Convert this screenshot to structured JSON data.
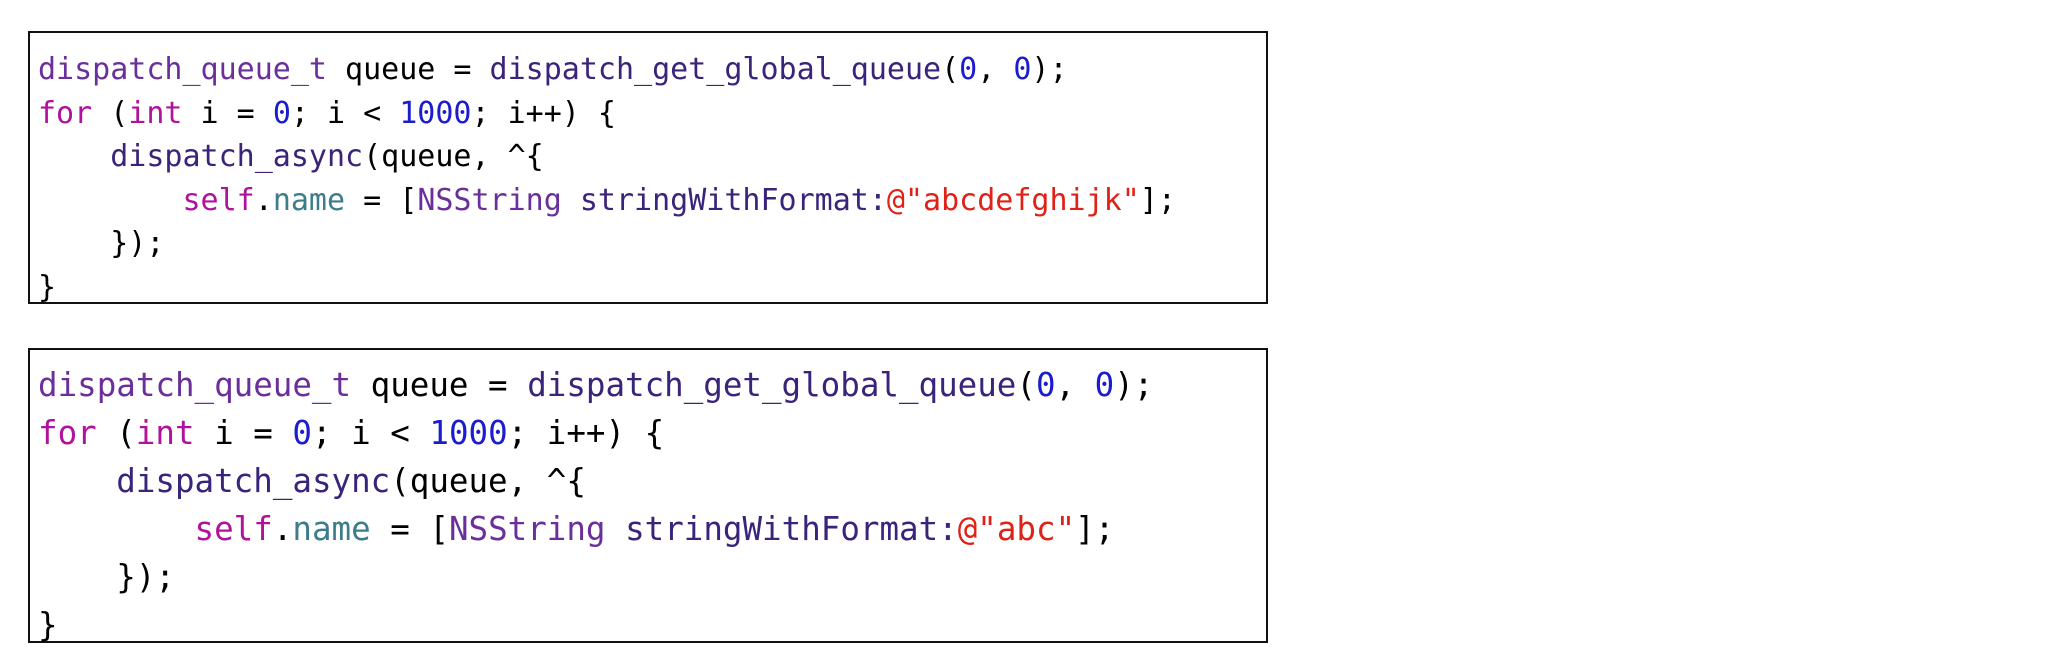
{
  "colors": {
    "plain": "#000000",
    "keyword": "#b0129c",
    "type": "#6a2f9a",
    "number": "#1c1ccf",
    "string": "#e02118",
    "property": "#3c7d8a",
    "class": "#6a2f9a",
    "method": "#3a237a"
  },
  "snippets": [
    {
      "lines": [
        [
          {
            "text": "dispatch_queue_t",
            "kind": "type"
          },
          {
            "text": " queue = ",
            "kind": "plain"
          },
          {
            "text": "dispatch_get_global_queue",
            "kind": "method"
          },
          {
            "text": "(",
            "kind": "plain"
          },
          {
            "text": "0",
            "kind": "number"
          },
          {
            "text": ", ",
            "kind": "plain"
          },
          {
            "text": "0",
            "kind": "number"
          },
          {
            "text": ");",
            "kind": "plain"
          }
        ],
        [
          {
            "text": "for",
            "kind": "keyword"
          },
          {
            "text": " (",
            "kind": "plain"
          },
          {
            "text": "int",
            "kind": "keyword"
          },
          {
            "text": " i = ",
            "kind": "plain"
          },
          {
            "text": "0",
            "kind": "number"
          },
          {
            "text": "; i < ",
            "kind": "plain"
          },
          {
            "text": "1000",
            "kind": "number"
          },
          {
            "text": "; i++) {",
            "kind": "plain"
          }
        ],
        [
          {
            "text": "    ",
            "kind": "plain"
          },
          {
            "text": "dispatch_async",
            "kind": "method"
          },
          {
            "text": "(queue, ^{",
            "kind": "plain"
          }
        ],
        [
          {
            "text": "        ",
            "kind": "plain"
          },
          {
            "text": "self",
            "kind": "keyword"
          },
          {
            "text": ".",
            "kind": "plain"
          },
          {
            "text": "name",
            "kind": "property"
          },
          {
            "text": " = [",
            "kind": "plain"
          },
          {
            "text": "NSString",
            "kind": "class"
          },
          {
            "text": " ",
            "kind": "plain"
          },
          {
            "text": "stringWithFormat:",
            "kind": "method"
          },
          {
            "text": "@\"abcdefghijk\"",
            "kind": "string"
          },
          {
            "text": "];",
            "kind": "plain"
          }
        ],
        [
          {
            "text": "    });",
            "kind": "plain"
          }
        ],
        [
          {
            "text": "}",
            "kind": "plain"
          }
        ]
      ]
    },
    {
      "lines": [
        [
          {
            "text": "dispatch_queue_t",
            "kind": "type"
          },
          {
            "text": " queue = ",
            "kind": "plain"
          },
          {
            "text": "dispatch_get_global_queue",
            "kind": "method"
          },
          {
            "text": "(",
            "kind": "plain"
          },
          {
            "text": "0",
            "kind": "number"
          },
          {
            "text": ", ",
            "kind": "plain"
          },
          {
            "text": "0",
            "kind": "number"
          },
          {
            "text": ");",
            "kind": "plain"
          }
        ],
        [
          {
            "text": "for",
            "kind": "keyword"
          },
          {
            "text": " (",
            "kind": "plain"
          },
          {
            "text": "int",
            "kind": "keyword"
          },
          {
            "text": " i = ",
            "kind": "plain"
          },
          {
            "text": "0",
            "kind": "number"
          },
          {
            "text": "; i < ",
            "kind": "plain"
          },
          {
            "text": "1000",
            "kind": "number"
          },
          {
            "text": "; i++) {",
            "kind": "plain"
          }
        ],
        [
          {
            "text": "    ",
            "kind": "plain"
          },
          {
            "text": "dispatch_async",
            "kind": "method"
          },
          {
            "text": "(queue, ^{",
            "kind": "plain"
          }
        ],
        [
          {
            "text": "        ",
            "kind": "plain"
          },
          {
            "text": "self",
            "kind": "keyword"
          },
          {
            "text": ".",
            "kind": "plain"
          },
          {
            "text": "name",
            "kind": "property"
          },
          {
            "text": " = [",
            "kind": "plain"
          },
          {
            "text": "NSString",
            "kind": "class"
          },
          {
            "text": " ",
            "kind": "plain"
          },
          {
            "text": "stringWithFormat:",
            "kind": "method"
          },
          {
            "text": "@\"abc\"",
            "kind": "string"
          },
          {
            "text": "];",
            "kind": "plain"
          }
        ],
        [
          {
            "text": "    });",
            "kind": "plain"
          }
        ],
        [
          {
            "text": "}",
            "kind": "plain"
          }
        ]
      ]
    }
  ]
}
